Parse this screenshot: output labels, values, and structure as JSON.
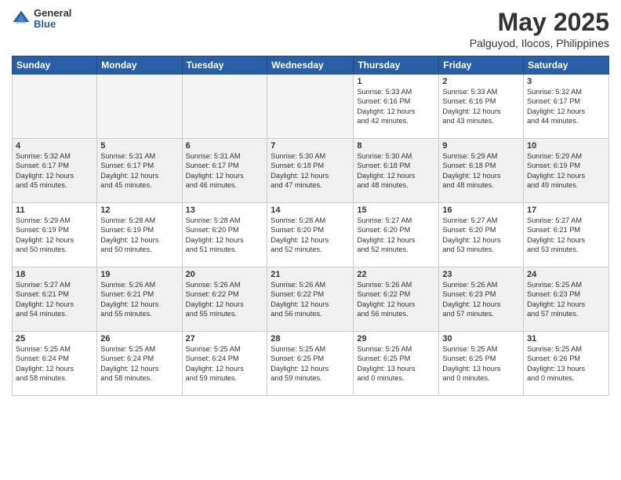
{
  "logo": {
    "general": "General",
    "blue": "Blue"
  },
  "title": "May 2025",
  "location": "Palguyod, Ilocos, Philippines",
  "days_header": [
    "Sunday",
    "Monday",
    "Tuesday",
    "Wednesday",
    "Thursday",
    "Friday",
    "Saturday"
  ],
  "weeks": [
    [
      {
        "day": "",
        "info": "",
        "empty": true
      },
      {
        "day": "",
        "info": "",
        "empty": true
      },
      {
        "day": "",
        "info": "",
        "empty": true
      },
      {
        "day": "",
        "info": "",
        "empty": true
      },
      {
        "day": "1",
        "info": "Sunrise: 5:33 AM\nSunset: 6:16 PM\nDaylight: 12 hours\nand 42 minutes.",
        "empty": false
      },
      {
        "day": "2",
        "info": "Sunrise: 5:33 AM\nSunset: 6:16 PM\nDaylight: 12 hours\nand 43 minutes.",
        "empty": false
      },
      {
        "day": "3",
        "info": "Sunrise: 5:32 AM\nSunset: 6:17 PM\nDaylight: 12 hours\nand 44 minutes.",
        "empty": false
      }
    ],
    [
      {
        "day": "4",
        "info": "Sunrise: 5:32 AM\nSunset: 6:17 PM\nDaylight: 12 hours\nand 45 minutes.",
        "empty": false
      },
      {
        "day": "5",
        "info": "Sunrise: 5:31 AM\nSunset: 6:17 PM\nDaylight: 12 hours\nand 45 minutes.",
        "empty": false
      },
      {
        "day": "6",
        "info": "Sunrise: 5:31 AM\nSunset: 6:17 PM\nDaylight: 12 hours\nand 46 minutes.",
        "empty": false
      },
      {
        "day": "7",
        "info": "Sunrise: 5:30 AM\nSunset: 6:18 PM\nDaylight: 12 hours\nand 47 minutes.",
        "empty": false
      },
      {
        "day": "8",
        "info": "Sunrise: 5:30 AM\nSunset: 6:18 PM\nDaylight: 12 hours\nand 48 minutes.",
        "empty": false
      },
      {
        "day": "9",
        "info": "Sunrise: 5:29 AM\nSunset: 6:18 PM\nDaylight: 12 hours\nand 48 minutes.",
        "empty": false
      },
      {
        "day": "10",
        "info": "Sunrise: 5:29 AM\nSunset: 6:19 PM\nDaylight: 12 hours\nand 49 minutes.",
        "empty": false
      }
    ],
    [
      {
        "day": "11",
        "info": "Sunrise: 5:29 AM\nSunset: 6:19 PM\nDaylight: 12 hours\nand 50 minutes.",
        "empty": false
      },
      {
        "day": "12",
        "info": "Sunrise: 5:28 AM\nSunset: 6:19 PM\nDaylight: 12 hours\nand 50 minutes.",
        "empty": false
      },
      {
        "day": "13",
        "info": "Sunrise: 5:28 AM\nSunset: 6:20 PM\nDaylight: 12 hours\nand 51 minutes.",
        "empty": false
      },
      {
        "day": "14",
        "info": "Sunrise: 5:28 AM\nSunset: 6:20 PM\nDaylight: 12 hours\nand 52 minutes.",
        "empty": false
      },
      {
        "day": "15",
        "info": "Sunrise: 5:27 AM\nSunset: 6:20 PM\nDaylight: 12 hours\nand 52 minutes.",
        "empty": false
      },
      {
        "day": "16",
        "info": "Sunrise: 5:27 AM\nSunset: 6:20 PM\nDaylight: 12 hours\nand 53 minutes.",
        "empty": false
      },
      {
        "day": "17",
        "info": "Sunrise: 5:27 AM\nSunset: 6:21 PM\nDaylight: 12 hours\nand 53 minutes.",
        "empty": false
      }
    ],
    [
      {
        "day": "18",
        "info": "Sunrise: 5:27 AM\nSunset: 6:21 PM\nDaylight: 12 hours\nand 54 minutes.",
        "empty": false
      },
      {
        "day": "19",
        "info": "Sunrise: 5:26 AM\nSunset: 6:21 PM\nDaylight: 12 hours\nand 55 minutes.",
        "empty": false
      },
      {
        "day": "20",
        "info": "Sunrise: 5:26 AM\nSunset: 6:22 PM\nDaylight: 12 hours\nand 55 minutes.",
        "empty": false
      },
      {
        "day": "21",
        "info": "Sunrise: 5:26 AM\nSunset: 6:22 PM\nDaylight: 12 hours\nand 56 minutes.",
        "empty": false
      },
      {
        "day": "22",
        "info": "Sunrise: 5:26 AM\nSunset: 6:22 PM\nDaylight: 12 hours\nand 56 minutes.",
        "empty": false
      },
      {
        "day": "23",
        "info": "Sunrise: 5:26 AM\nSunset: 6:23 PM\nDaylight: 12 hours\nand 57 minutes.",
        "empty": false
      },
      {
        "day": "24",
        "info": "Sunrise: 5:25 AM\nSunset: 6:23 PM\nDaylight: 12 hours\nand 57 minutes.",
        "empty": false
      }
    ],
    [
      {
        "day": "25",
        "info": "Sunrise: 5:25 AM\nSunset: 6:24 PM\nDaylight: 12 hours\nand 58 minutes.",
        "empty": false
      },
      {
        "day": "26",
        "info": "Sunrise: 5:25 AM\nSunset: 6:24 PM\nDaylight: 12 hours\nand 58 minutes.",
        "empty": false
      },
      {
        "day": "27",
        "info": "Sunrise: 5:25 AM\nSunset: 6:24 PM\nDaylight: 12 hours\nand 59 minutes.",
        "empty": false
      },
      {
        "day": "28",
        "info": "Sunrise: 5:25 AM\nSunset: 6:25 PM\nDaylight: 12 hours\nand 59 minutes.",
        "empty": false
      },
      {
        "day": "29",
        "info": "Sunrise: 5:25 AM\nSunset: 6:25 PM\nDaylight: 13 hours\nand 0 minutes.",
        "empty": false
      },
      {
        "day": "30",
        "info": "Sunrise: 5:25 AM\nSunset: 6:25 PM\nDaylight: 13 hours\nand 0 minutes.",
        "empty": false
      },
      {
        "day": "31",
        "info": "Sunrise: 5:25 AM\nSunset: 6:26 PM\nDaylight: 13 hours\nand 0 minutes.",
        "empty": false
      }
    ]
  ]
}
